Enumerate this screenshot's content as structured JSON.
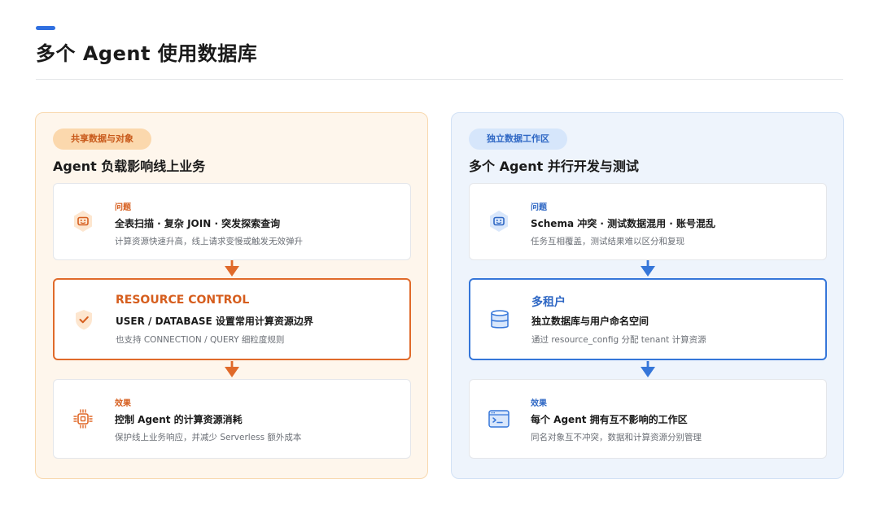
{
  "title": "多个 Agent 使用数据库",
  "colors": {
    "accent": "#2f6fe0",
    "left_accent": "#e06a2a",
    "right_accent": "#3576d9",
    "left_panel_bg": "#fef6ec",
    "right_panel_bg": "#eef4fc"
  },
  "left": {
    "pill": "共享数据与对象",
    "heading": "Agent 负载影响线上业务",
    "cards": [
      {
        "label": "问题",
        "main": "全表扫描 · 复杂 JOIN · 突发探索查询",
        "sub": "计算资源快速升高，线上请求变慢或触发无效弹升",
        "icon": "robot-icon"
      },
      {
        "label": "RESOURCE CONTROL",
        "main": "USER / DATABASE 设置常用计算资源边界",
        "sub": "也支持 CONNECTION / QUERY 细粒度规则",
        "icon": "shield-check-icon"
      },
      {
        "label": "效果",
        "main": "控制 Agent 的计算资源消耗",
        "sub": "保护线上业务响应，并减少 Serverless 额外成本",
        "icon": "chip-icon"
      }
    ]
  },
  "right": {
    "pill": "独立数据工作区",
    "heading": "多个 Agent 并行开发与测试",
    "cards": [
      {
        "label": "问题",
        "main": "Schema 冲突 · 测试数据混用 · 账号混乱",
        "sub": "任务互相覆盖，测试结果难以区分和复现",
        "icon": "robot-icon"
      },
      {
        "label": "多租户",
        "main": "独立数据库与用户命名空间",
        "sub": "通过 resource_config 分配 tenant 计算资源",
        "icon": "database-icon"
      },
      {
        "label": "效果",
        "main": "每个 Agent 拥有互不影响的工作区",
        "sub": "同名对象互不冲突，数据和计算资源分别管理",
        "icon": "terminal-icon"
      }
    ]
  }
}
